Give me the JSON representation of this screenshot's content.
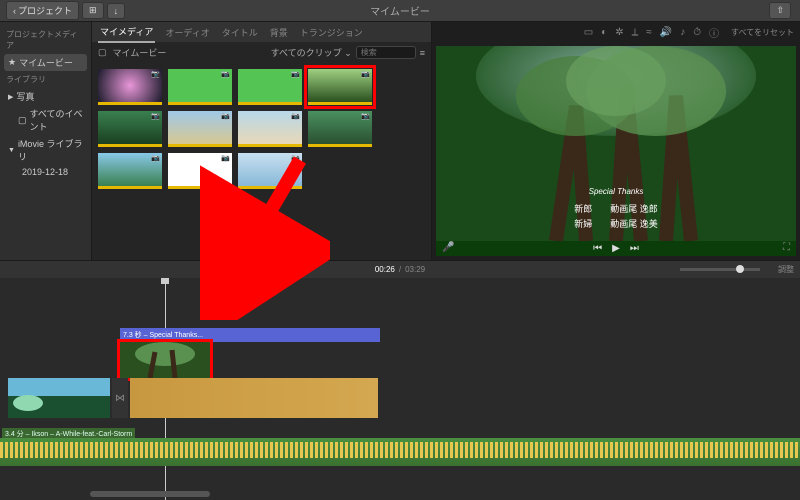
{
  "toolbar": {
    "back": "プロジェクト",
    "media": "⊞",
    "add": "↓",
    "title": "マイムービー",
    "share": "⇧"
  },
  "sidebar": {
    "header1": "プロジェクトメディア",
    "project": "マイムービー",
    "header2": "ライブラリ",
    "photos": "写真",
    "events": "すべてのイベント",
    "library": "iMovie ライブラリ",
    "date": "2019-12-18"
  },
  "tabs": [
    "マイメディア",
    "オーディオ",
    "タイトル",
    "背景",
    "トランジション"
  ],
  "browser": {
    "name": "マイムービー",
    "filter": "すべてのクリップ",
    "search_placeholder": "検索"
  },
  "preview": {
    "reset": "すべてをリセット",
    "credits_title": "Special Thanks",
    "role1": "新郎",
    "name1": "動画尾 逸郎",
    "role2": "新婦",
    "name2": "動画尾 逸美"
  },
  "timeline": {
    "current": "00:26",
    "total": "03:29",
    "adjust": "調整",
    "title_clip": "7.3 秒 – Special Thanks...",
    "audio_label": "3.4 分 – Ikson – A-While-feat.-Carl-Storm"
  }
}
